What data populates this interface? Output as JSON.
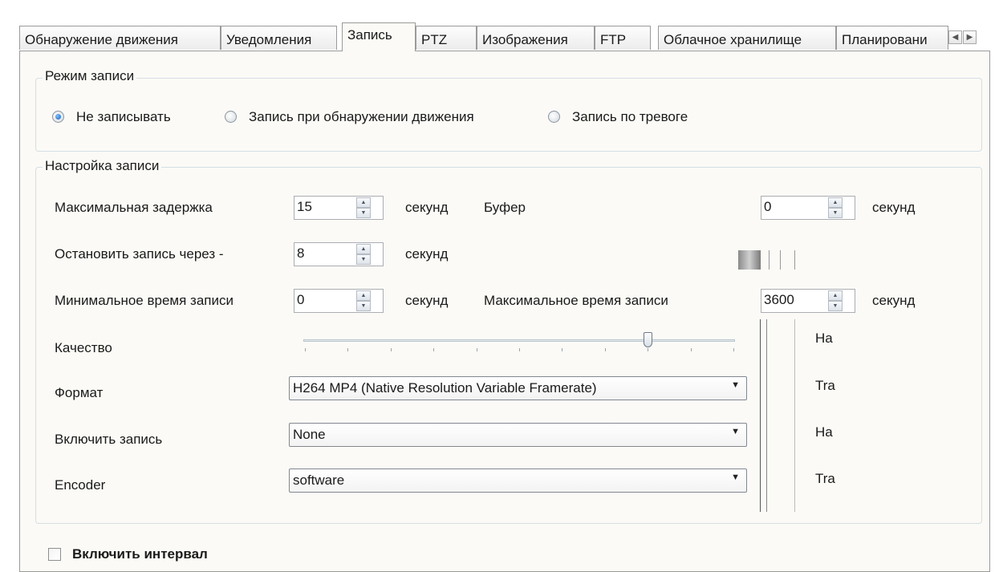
{
  "tabs": [
    {
      "label": "Обнаружение движения",
      "active": false
    },
    {
      "label": "Уведомления",
      "active": false
    },
    {
      "label": "Запись",
      "active": true
    },
    {
      "label": "PTZ",
      "active": false
    },
    {
      "label": "Изображения",
      "active": false
    },
    {
      "label": "FTP",
      "active": false
    },
    {
      "label": "Облачное хранилище",
      "active": false
    },
    {
      "label": "Планировани",
      "active": false
    }
  ],
  "tab_scroll": {
    "left_icon": "arrow-left-icon",
    "right_icon": "arrow-right-icon"
  },
  "record_mode": {
    "legend": "Режим записи",
    "options": [
      {
        "label": "Не записывать",
        "checked": true
      },
      {
        "label": "Запись при обнаружении движения",
        "checked": false
      },
      {
        "label": "Запись по тревоге",
        "checked": false
      }
    ]
  },
  "record_settings": {
    "legend": "Настройка записи",
    "max_delay": {
      "label": "Максимальная задержка",
      "value": "15",
      "unit": "секунд"
    },
    "buffer": {
      "label": "Буфер",
      "value": "0",
      "unit": "секунд"
    },
    "stop_after": {
      "label": "Остановить запись через -",
      "value": "8",
      "unit": "секунд"
    },
    "min_time": {
      "label": "Минимальное время записи",
      "value": "0",
      "unit": "секунд"
    },
    "max_time": {
      "label": "Максимальное время записи",
      "value": "3600",
      "unit": "секунд"
    },
    "quality": {
      "label": "Качество",
      "level": 0.8
    },
    "format": {
      "label": "Формат",
      "value": "H264 MP4 (Native Resolution Variable Framerate)"
    },
    "enable_record": {
      "label": "Включить запись",
      "value": "None"
    },
    "encoder": {
      "label": "Encoder",
      "value": "software"
    },
    "side_labels": [
      "Ha",
      "Tra",
      "Ha",
      "Tra"
    ]
  },
  "interval": {
    "label": "Включить интервал",
    "checked": false
  },
  "colors": {
    "panel_bg": "#fbfaf6",
    "radio_dot": "#1a5fb4",
    "border": "#9a9a9a"
  }
}
